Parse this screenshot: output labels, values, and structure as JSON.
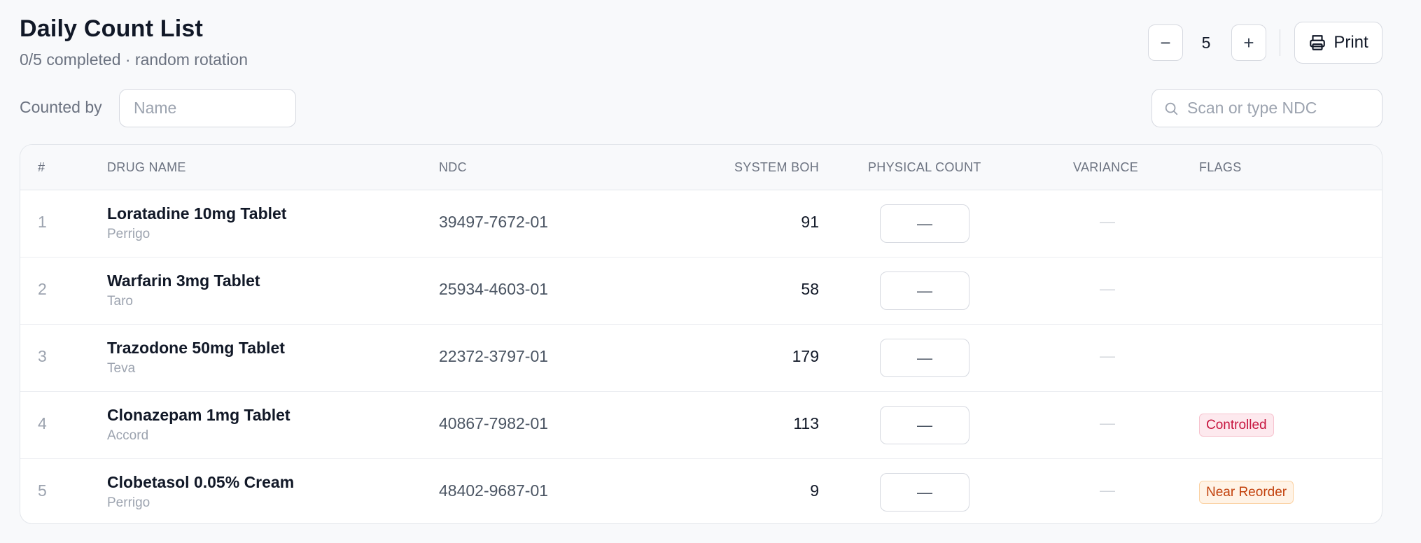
{
  "header": {
    "title": "Daily Count List",
    "subtitle": "0/5 completed · random rotation"
  },
  "stepper": {
    "decrement_label": "−",
    "value": "5",
    "increment_label": "+"
  },
  "print_button": {
    "label": "Print",
    "icon": "printer-icon"
  },
  "counted_by": {
    "label": "Counted by",
    "placeholder": "Name",
    "value": ""
  },
  "search": {
    "placeholder": "Scan or type NDC",
    "value": "",
    "icon": "search-icon"
  },
  "table": {
    "columns": {
      "index": "#",
      "drug_name": "DRUG NAME",
      "ndc": "NDC",
      "system_boh": "SYSTEM BOH",
      "physical_count": "PHYSICAL COUNT",
      "variance": "VARIANCE",
      "flags": "FLAGS"
    },
    "rows": [
      {
        "index": "1",
        "name": "Loratadine 10mg Tablet",
        "manufacturer": "Perrigo",
        "ndc": "39497-7672-01",
        "boh": "91",
        "count": "—",
        "variance": "—",
        "flag": ""
      },
      {
        "index": "2",
        "name": "Warfarin 3mg Tablet",
        "manufacturer": "Taro",
        "ndc": "25934-4603-01",
        "boh": "58",
        "count": "—",
        "variance": "—",
        "flag": ""
      },
      {
        "index": "3",
        "name": "Trazodone 50mg Tablet",
        "manufacturer": "Teva",
        "ndc": "22372-3797-01",
        "boh": "179",
        "count": "—",
        "variance": "—",
        "flag": ""
      },
      {
        "index": "4",
        "name": "Clonazepam 1mg Tablet",
        "manufacturer": "Accord",
        "ndc": "40867-7982-01",
        "boh": "113",
        "count": "—",
        "variance": "—",
        "flag": "Controlled"
      },
      {
        "index": "5",
        "name": "Clobetasol 0.05% Cream",
        "manufacturer": "Perrigo",
        "ndc": "48402-9687-01",
        "boh": "9",
        "count": "—",
        "variance": "—",
        "flag": "Near Reorder"
      }
    ]
  },
  "colors": {
    "controlled_text": "#c7153f",
    "controlled_bg": "#fde9ee",
    "reorder_text": "#c2410c",
    "reorder_bg": "#fff3e6"
  }
}
